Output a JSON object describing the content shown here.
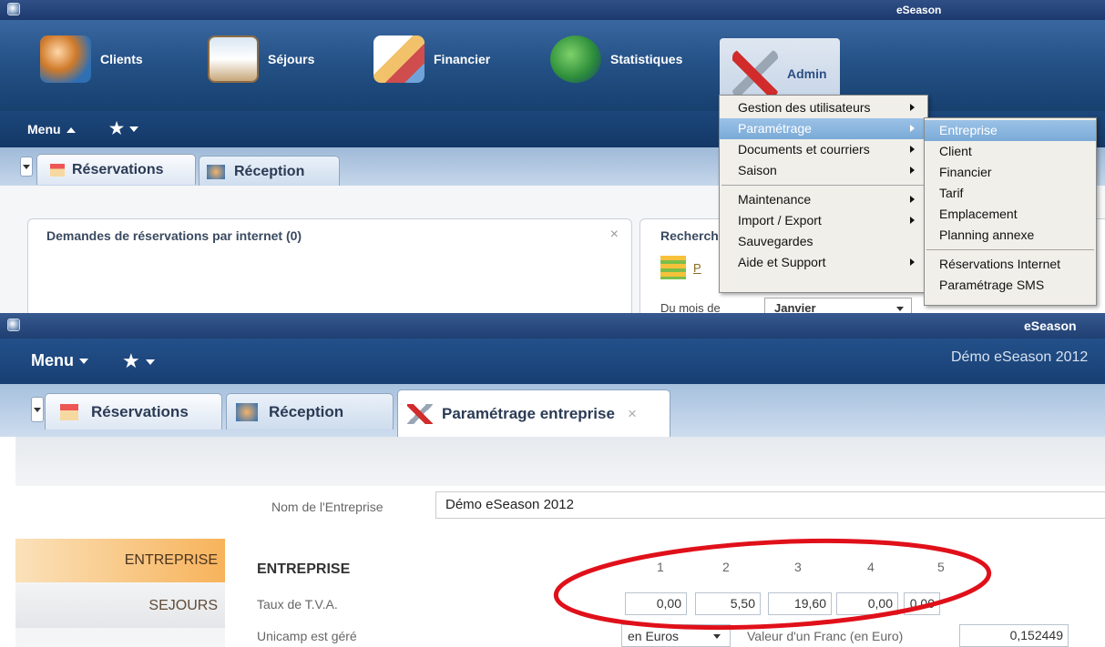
{
  "top_window": {
    "title": "eSeason",
    "ribbon": [
      {
        "label": "Clients",
        "icon": "clients-icon"
      },
      {
        "label": "Séjours",
        "icon": "house-icon"
      },
      {
        "label": "Financier",
        "icon": "documents-icon"
      },
      {
        "label": "Statistiques",
        "icon": "globe-chart-icon"
      },
      {
        "label": "Admin",
        "icon": "tools-icon"
      }
    ],
    "menu_label": "Menu",
    "tabs": [
      "Réservations",
      "Réception"
    ],
    "panel_left_title": "Demandes de réservations par internet (0)",
    "panel_right_title": "Recherch",
    "panel_right_link": "P",
    "month_label": "Du mois de",
    "month_value": "Janvier",
    "admin_menu": {
      "group1": [
        "Gestion des utilisateurs",
        "Paramétrage",
        "Documents et courriers",
        "Saison"
      ],
      "group2": [
        "Maintenance",
        "Import / Export",
        "Sauvegardes",
        "Aide et Support"
      ]
    },
    "param_menu": {
      "group1": [
        "Entreprise",
        "Client",
        "Financier",
        "Tarif",
        "Emplacement",
        "Planning annexe"
      ],
      "group2": [
        "Réservations Internet",
        "Paramétrage SMS"
      ]
    }
  },
  "bottom_window": {
    "title": "eSeason",
    "menu_label": "Menu",
    "company_header": "Démo eSeason 2012",
    "tabs": [
      "Réservations",
      "Réception",
      "Paramétrage entreprise"
    ],
    "company_name_label": "Nom de l'Entreprise",
    "company_name_value": "Démo eSeason 2012",
    "sidebar": [
      "ENTREPRISE",
      "SEJOURS"
    ],
    "section_title": "ENTREPRISE",
    "vat_label": "Taux de T.V.A.",
    "vat_columns": [
      "1",
      "2",
      "3",
      "4",
      "5"
    ],
    "vat_values": [
      "0,00",
      "5,50",
      "19,60",
      "0,00",
      "0,00"
    ],
    "unicamp_label": "Unicamp est géré",
    "currency_value": "en Euros",
    "franc_label": "Valeur d'un Franc (en Euro)",
    "franc_value": "0,152449"
  },
  "colors": {
    "accent": "#1d3a6e",
    "highlight": "#7aaad8",
    "annotation": "#e0101a",
    "sidebar_active": "#f7b35b"
  }
}
